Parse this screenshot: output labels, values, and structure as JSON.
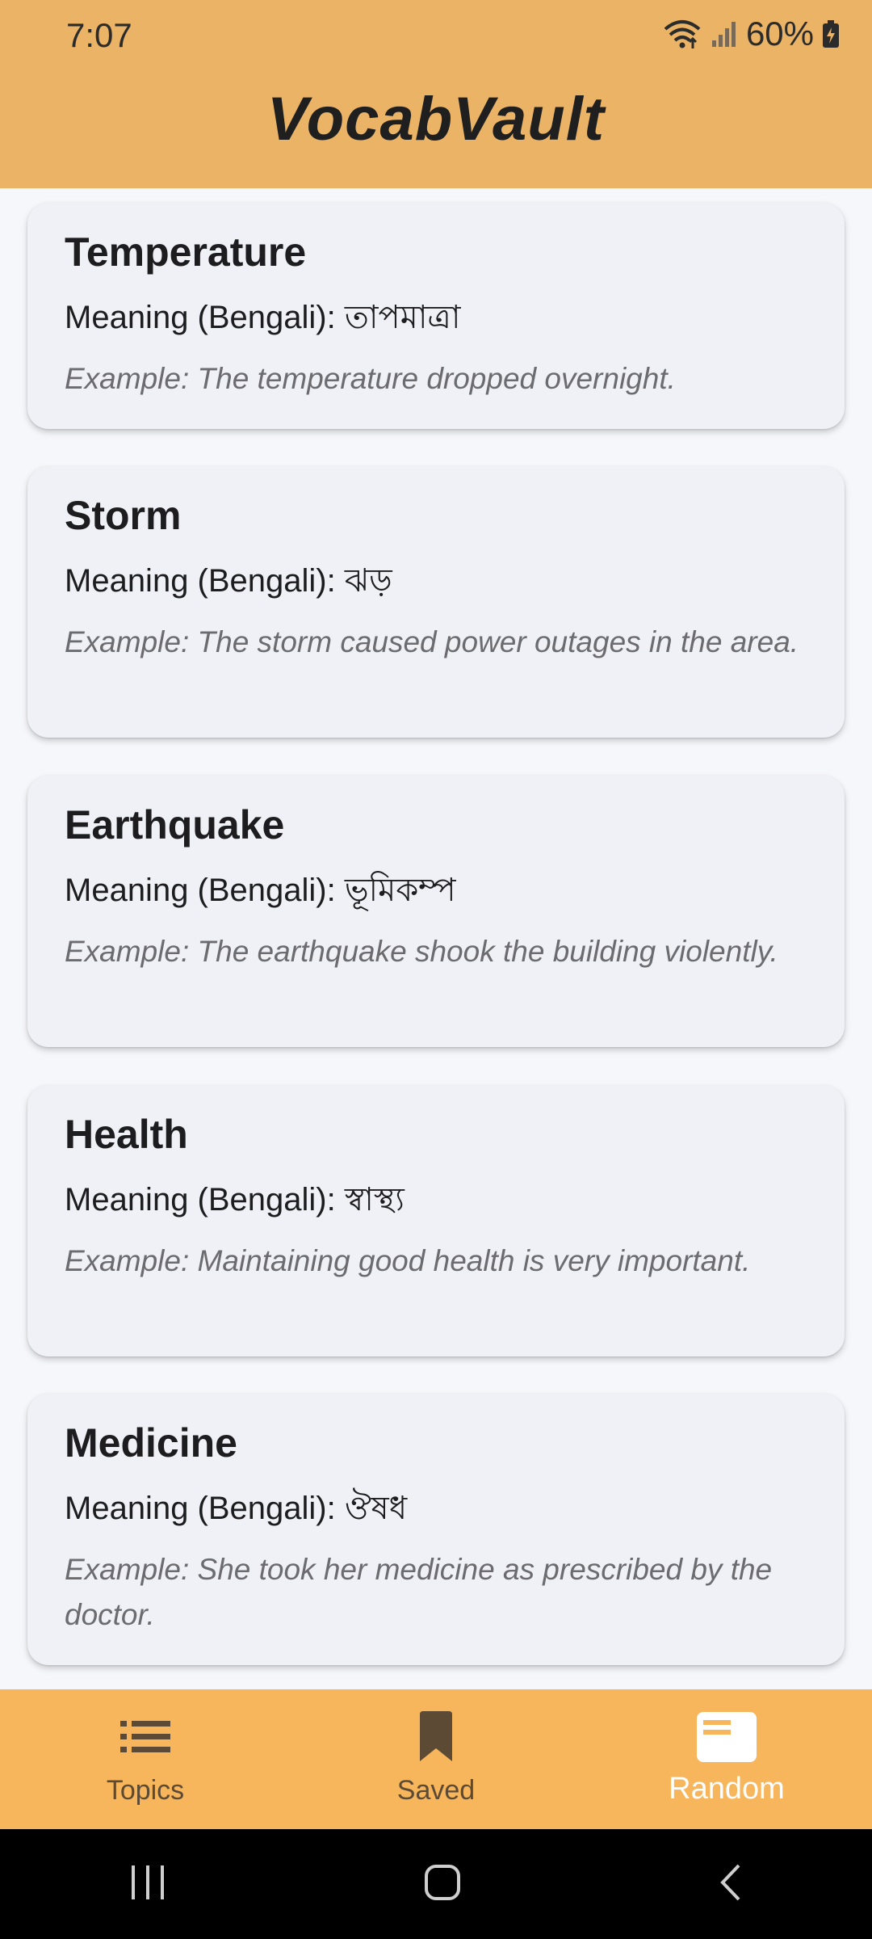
{
  "status": {
    "time": "7:07",
    "battery": "60%",
    "icons": [
      "wifi-icon",
      "signal-icon",
      "battery-icon"
    ]
  },
  "app": {
    "title": "VocabVault"
  },
  "cards": [
    {
      "word": "Temperature",
      "meaning": "Meaning (Bengali): তাপমাত্রা",
      "example": "Example: The temperature dropped overnight."
    },
    {
      "word": "Storm",
      "meaning": "Meaning (Bengali): ঝড়",
      "example": "Example: The storm caused power outages in the area."
    },
    {
      "word": "Earthquake",
      "meaning": "Meaning (Bengali): ভূমিকম্প",
      "example": "Example: The earthquake shook the building violently."
    },
    {
      "word": "Health",
      "meaning": "Meaning (Bengali): স্বাস্থ্য",
      "example": "Example: Maintaining good health is very important."
    },
    {
      "word": "Medicine",
      "meaning": "Meaning (Bengali): ঔষধ",
      "example": "Example: She took her medicine as prescribed by the doctor."
    }
  ],
  "nav": {
    "items": [
      {
        "label": "Topics",
        "icon": "list-icon"
      },
      {
        "label": "Saved",
        "icon": "bookmark-icon"
      },
      {
        "label": "Random",
        "icon": "card-icon",
        "active": true
      }
    ]
  },
  "system_nav": {
    "icons": [
      "recents-icon",
      "home-icon",
      "back-icon"
    ]
  },
  "colors": {
    "app_bar": "#ebb365",
    "bottom_nav": "#f8b65c",
    "card": "#f0f1f7",
    "background": "#f6f7fb"
  }
}
